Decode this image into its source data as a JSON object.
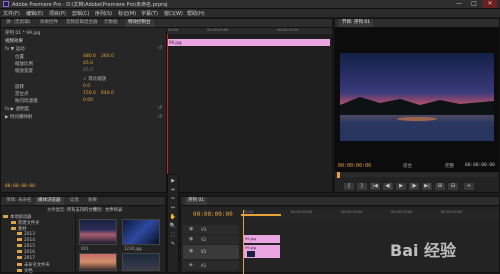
{
  "window": {
    "title": "Adobe Premiere Pro - D:\\文档\\Adobe\\Premiere Pro\\未命名.prproj",
    "minimize": "—",
    "maximize": "□",
    "close": "✕"
  },
  "menu": [
    "文件(F)",
    "编辑(E)",
    "项目(P)",
    "剪辑(C)",
    "序列(S)",
    "标记(M)",
    "字幕(T)",
    "窗口(W)",
    "帮助(H)"
  ],
  "effect_controls": {
    "tabs": [
      "源: (无剪辑)",
      "效果控件",
      "音频剪辑混合器",
      "元数据",
      "特效控制台"
    ],
    "clip_header": "序列 01 * 99.jpg",
    "section_video": "视频效果",
    "motion": "fx  ▼ 运动",
    "position": {
      "label": "位置",
      "x": "480.0",
      "y": "260.0"
    },
    "scale": {
      "label": "缩放比例",
      "value": "45.0"
    },
    "scale_width": {
      "label": "缩放宽度",
      "value": "45.0"
    },
    "uniform": "✓ 等比缩放",
    "rotation": {
      "label": "旋转",
      "value": "0.0"
    },
    "anchor": {
      "label": "定位点",
      "x": "150.0",
      "y": "640.0"
    },
    "antiflicker": {
      "label": "防闪烁滤镜",
      "value": "0.00"
    },
    "opacity": "fx  ▶ 透明度",
    "time_remap": "▶ 时间重映射",
    "clip_bar_label": "99.jpg",
    "ruler": [
      "00:00",
      "00:00:05:00",
      "00:00:10:00"
    ],
    "timecode": "00:00:00:00"
  },
  "program": {
    "tab": "节目: 序列 01",
    "timecode_left": "00:00:00:00",
    "fit": "适合",
    "full": "完整",
    "timecode_right": "00:00:00:00",
    "buttons": [
      "{",
      "}",
      "|◀",
      "◀|",
      "▶",
      "|▶",
      "▶|",
      "⊞",
      "⊟",
      "+"
    ]
  },
  "project": {
    "tabs": [
      "项目: 未命名",
      "媒体浏览器",
      "信息",
      "效果"
    ],
    "filter_label": "文件类型:",
    "filter_value": "所有支持的文件",
    "view_label": "视图:",
    "view_value": "文件目录",
    "folders": [
      "本地驱动器",
      "C:",
      "D:",
      "新建文件夹",
      "2013",
      "2014",
      "2015",
      "2016",
      "2017",
      "素材",
      "未命名文件夹",
      "文档"
    ],
    "thumbs": [
      "001",
      "1230.jpg",
      "99.jpg"
    ]
  },
  "timeline": {
    "tab": "序列 01",
    "timecode": "00:00:00:00",
    "ruler": [
      "00:00",
      "00:00:05:00",
      "00:00:10:00",
      "00:00:15:00",
      "00:00:20:00"
    ],
    "tracks": [
      "V3",
      "V2",
      "V1",
      "A1"
    ],
    "clip_v2": "99.jpg",
    "clip_v1": "99.jpg"
  },
  "tools": [
    "▶",
    "⇹",
    "✂",
    "↔",
    "✋",
    "🔍",
    "⬚",
    "✎"
  ],
  "watermark": "Bai 经验"
}
